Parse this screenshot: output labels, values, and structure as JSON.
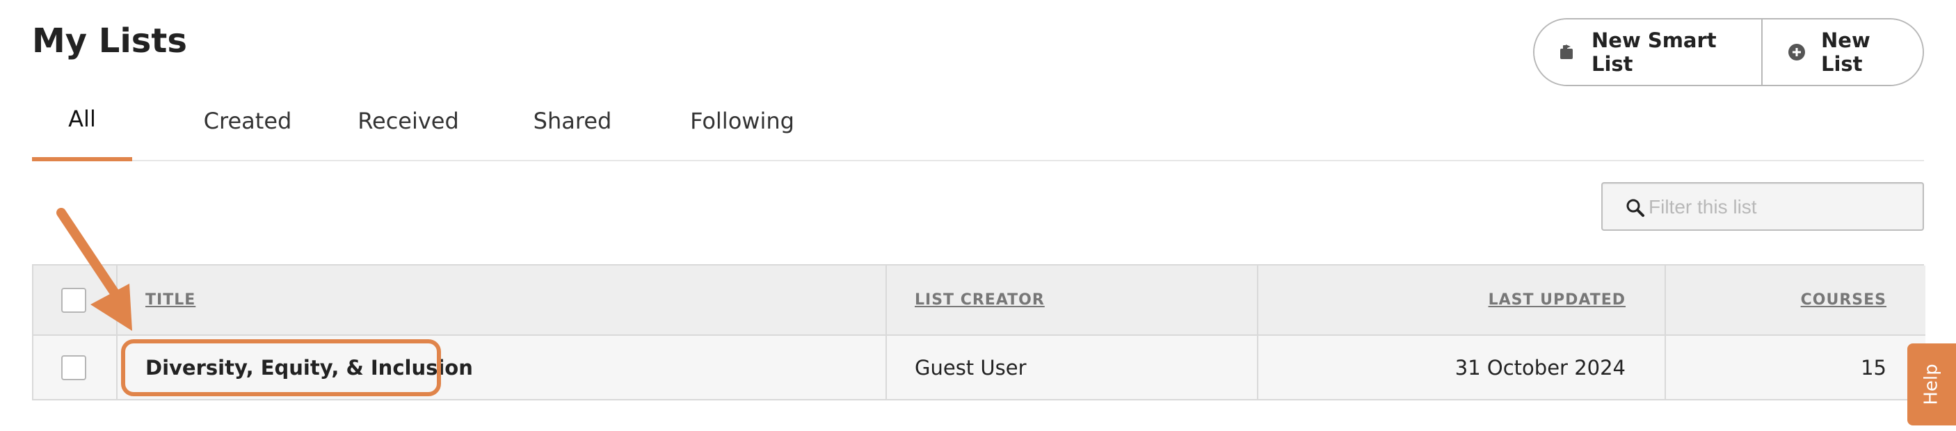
{
  "page": {
    "title": "My Lists"
  },
  "actions": {
    "new_smart_list": "New Smart List",
    "new_list": "New List"
  },
  "tabs": [
    {
      "label": "All",
      "active": true
    },
    {
      "label": "Created",
      "active": false
    },
    {
      "label": "Received",
      "active": false
    },
    {
      "label": "Shared",
      "active": false
    },
    {
      "label": "Following",
      "active": false
    }
  ],
  "filter": {
    "placeholder": "Filter this list",
    "value": ""
  },
  "table": {
    "columns": {
      "title": "TITLE",
      "list_creator": "LIST CREATOR",
      "last_updated": "LAST UPDATED",
      "courses": "COURSES"
    },
    "rows": [
      {
        "title": "Diversity, Equity, & Inclusion",
        "list_creator": "Guest User",
        "last_updated": "31 October 2024",
        "courses": "15"
      }
    ]
  },
  "help": {
    "label": "Help"
  },
  "colors": {
    "accent": "#e0844a",
    "header_bg": "#eeeeee",
    "row_bg": "#f6f6f6",
    "border": "#d9d9d9"
  },
  "icons": {
    "smart_list": "smart-list-icon",
    "new_list": "plus-circle-icon",
    "search": "search-icon",
    "annotation_arrow": "arrow-annotation-icon"
  }
}
